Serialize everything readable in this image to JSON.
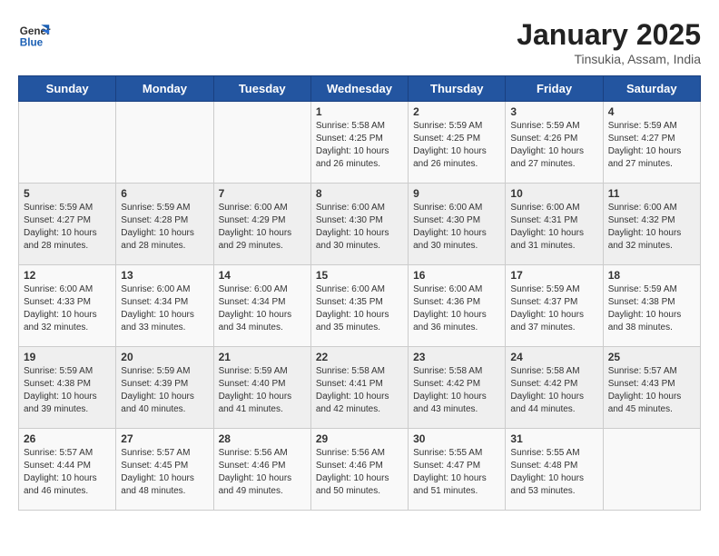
{
  "header": {
    "logo_line1": "General",
    "logo_line2": "Blue",
    "month_year": "January 2025",
    "location": "Tinsukia, Assam, India"
  },
  "weekdays": [
    "Sunday",
    "Monday",
    "Tuesday",
    "Wednesday",
    "Thursday",
    "Friday",
    "Saturday"
  ],
  "weeks": [
    [
      {
        "day": "",
        "sunrise": "",
        "sunset": "",
        "daylight": ""
      },
      {
        "day": "",
        "sunrise": "",
        "sunset": "",
        "daylight": ""
      },
      {
        "day": "",
        "sunrise": "",
        "sunset": "",
        "daylight": ""
      },
      {
        "day": "1",
        "sunrise": "Sunrise: 5:58 AM",
        "sunset": "Sunset: 4:25 PM",
        "daylight": "Daylight: 10 hours and 26 minutes."
      },
      {
        "day": "2",
        "sunrise": "Sunrise: 5:59 AM",
        "sunset": "Sunset: 4:25 PM",
        "daylight": "Daylight: 10 hours and 26 minutes."
      },
      {
        "day": "3",
        "sunrise": "Sunrise: 5:59 AM",
        "sunset": "Sunset: 4:26 PM",
        "daylight": "Daylight: 10 hours and 27 minutes."
      },
      {
        "day": "4",
        "sunrise": "Sunrise: 5:59 AM",
        "sunset": "Sunset: 4:27 PM",
        "daylight": "Daylight: 10 hours and 27 minutes."
      }
    ],
    [
      {
        "day": "5",
        "sunrise": "Sunrise: 5:59 AM",
        "sunset": "Sunset: 4:27 PM",
        "daylight": "Daylight: 10 hours and 28 minutes."
      },
      {
        "day": "6",
        "sunrise": "Sunrise: 5:59 AM",
        "sunset": "Sunset: 4:28 PM",
        "daylight": "Daylight: 10 hours and 28 minutes."
      },
      {
        "day": "7",
        "sunrise": "Sunrise: 6:00 AM",
        "sunset": "Sunset: 4:29 PM",
        "daylight": "Daylight: 10 hours and 29 minutes."
      },
      {
        "day": "8",
        "sunrise": "Sunrise: 6:00 AM",
        "sunset": "Sunset: 4:30 PM",
        "daylight": "Daylight: 10 hours and 30 minutes."
      },
      {
        "day": "9",
        "sunrise": "Sunrise: 6:00 AM",
        "sunset": "Sunset: 4:30 PM",
        "daylight": "Daylight: 10 hours and 30 minutes."
      },
      {
        "day": "10",
        "sunrise": "Sunrise: 6:00 AM",
        "sunset": "Sunset: 4:31 PM",
        "daylight": "Daylight: 10 hours and 31 minutes."
      },
      {
        "day": "11",
        "sunrise": "Sunrise: 6:00 AM",
        "sunset": "Sunset: 4:32 PM",
        "daylight": "Daylight: 10 hours and 32 minutes."
      }
    ],
    [
      {
        "day": "12",
        "sunrise": "Sunrise: 6:00 AM",
        "sunset": "Sunset: 4:33 PM",
        "daylight": "Daylight: 10 hours and 32 minutes."
      },
      {
        "day": "13",
        "sunrise": "Sunrise: 6:00 AM",
        "sunset": "Sunset: 4:34 PM",
        "daylight": "Daylight: 10 hours and 33 minutes."
      },
      {
        "day": "14",
        "sunrise": "Sunrise: 6:00 AM",
        "sunset": "Sunset: 4:34 PM",
        "daylight": "Daylight: 10 hours and 34 minutes."
      },
      {
        "day": "15",
        "sunrise": "Sunrise: 6:00 AM",
        "sunset": "Sunset: 4:35 PM",
        "daylight": "Daylight: 10 hours and 35 minutes."
      },
      {
        "day": "16",
        "sunrise": "Sunrise: 6:00 AM",
        "sunset": "Sunset: 4:36 PM",
        "daylight": "Daylight: 10 hours and 36 minutes."
      },
      {
        "day": "17",
        "sunrise": "Sunrise: 5:59 AM",
        "sunset": "Sunset: 4:37 PM",
        "daylight": "Daylight: 10 hours and 37 minutes."
      },
      {
        "day": "18",
        "sunrise": "Sunrise: 5:59 AM",
        "sunset": "Sunset: 4:38 PM",
        "daylight": "Daylight: 10 hours and 38 minutes."
      }
    ],
    [
      {
        "day": "19",
        "sunrise": "Sunrise: 5:59 AM",
        "sunset": "Sunset: 4:38 PM",
        "daylight": "Daylight: 10 hours and 39 minutes."
      },
      {
        "day": "20",
        "sunrise": "Sunrise: 5:59 AM",
        "sunset": "Sunset: 4:39 PM",
        "daylight": "Daylight: 10 hours and 40 minutes."
      },
      {
        "day": "21",
        "sunrise": "Sunrise: 5:59 AM",
        "sunset": "Sunset: 4:40 PM",
        "daylight": "Daylight: 10 hours and 41 minutes."
      },
      {
        "day": "22",
        "sunrise": "Sunrise: 5:58 AM",
        "sunset": "Sunset: 4:41 PM",
        "daylight": "Daylight: 10 hours and 42 minutes."
      },
      {
        "day": "23",
        "sunrise": "Sunrise: 5:58 AM",
        "sunset": "Sunset: 4:42 PM",
        "daylight": "Daylight: 10 hours and 43 minutes."
      },
      {
        "day": "24",
        "sunrise": "Sunrise: 5:58 AM",
        "sunset": "Sunset: 4:42 PM",
        "daylight": "Daylight: 10 hours and 44 minutes."
      },
      {
        "day": "25",
        "sunrise": "Sunrise: 5:57 AM",
        "sunset": "Sunset: 4:43 PM",
        "daylight": "Daylight: 10 hours and 45 minutes."
      }
    ],
    [
      {
        "day": "26",
        "sunrise": "Sunrise: 5:57 AM",
        "sunset": "Sunset: 4:44 PM",
        "daylight": "Daylight: 10 hours and 46 minutes."
      },
      {
        "day": "27",
        "sunrise": "Sunrise: 5:57 AM",
        "sunset": "Sunset: 4:45 PM",
        "daylight": "Daylight: 10 hours and 48 minutes."
      },
      {
        "day": "28",
        "sunrise": "Sunrise: 5:56 AM",
        "sunset": "Sunset: 4:46 PM",
        "daylight": "Daylight: 10 hours and 49 minutes."
      },
      {
        "day": "29",
        "sunrise": "Sunrise: 5:56 AM",
        "sunset": "Sunset: 4:46 PM",
        "daylight": "Daylight: 10 hours and 50 minutes."
      },
      {
        "day": "30",
        "sunrise": "Sunrise: 5:55 AM",
        "sunset": "Sunset: 4:47 PM",
        "daylight": "Daylight: 10 hours and 51 minutes."
      },
      {
        "day": "31",
        "sunrise": "Sunrise: 5:55 AM",
        "sunset": "Sunset: 4:48 PM",
        "daylight": "Daylight: 10 hours and 53 minutes."
      },
      {
        "day": "",
        "sunrise": "",
        "sunset": "",
        "daylight": ""
      }
    ]
  ]
}
